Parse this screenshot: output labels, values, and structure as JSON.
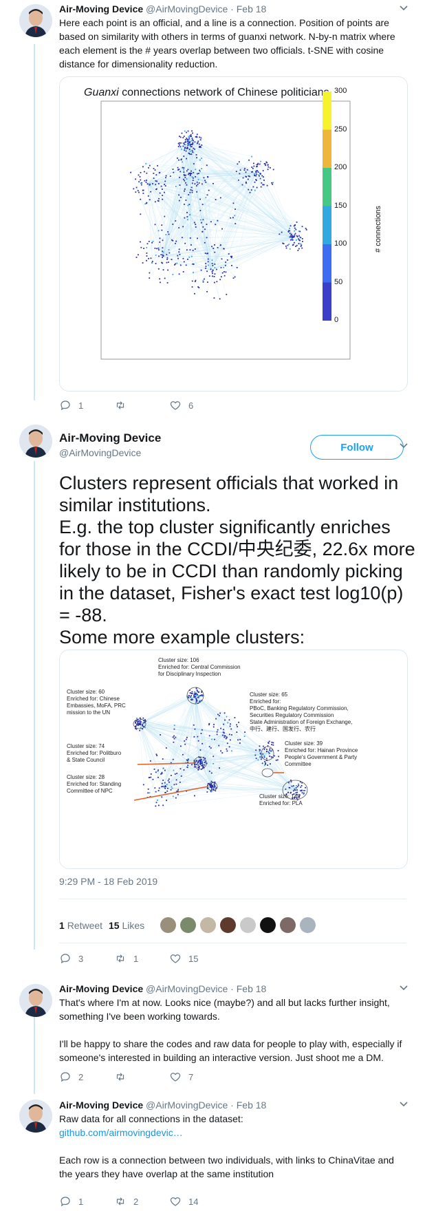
{
  "tweets": [
    {
      "name": "Air-Moving Device",
      "handle": "@AirMovingDevice",
      "date": "Feb 18",
      "text": "Here each point is an official, and a line is a connection. Position of points are based on similarity with others in terms of guanxi network. N-by-n matrix where each element is the # years overlap between two officials. t-SNE with cosine distance for dimensionality reduction.",
      "figure": {
        "title_italic": "Guanxi",
        "title_rest": " connections network of Chinese politicians",
        "colorbar_label": "# connections",
        "colorbar_ticks": [
          "300",
          "250",
          "200",
          "150",
          "100",
          "50",
          "0"
        ],
        "colorbar_colors": [
          "#f6f22e",
          "#eeb63a",
          "#44c884",
          "#2fa9e0",
          "#3d6cf3",
          "#3a3ec8",
          "#2c1d9a"
        ]
      },
      "replies": "1",
      "retweets": "",
      "likes": "6"
    },
    {
      "name": "Air-Moving Device",
      "handle": "@AirMovingDevice",
      "follow_label": "Follow",
      "text_lines": [
        "Clusters represent officials that worked in similar institutions.",
        "E.g. the top cluster significantly enriches for those in the CCDI/中央纪委, 22.6x more likely to be in CCDI than randomly picking in the dataset, Fisher's exact test log10(p) = -88.",
        "Some more example clusters:"
      ],
      "annotations": [
        "Cluster size: 106\nEnriched for: Central Commission\nfor Disciplinary Inspection",
        "Cluster size: 60\nEnriched for: Chinese\nEmbassies, MoFA, PRC\nmission to the UN",
        "Cluster size: 65\nEnriched for:\nPBoC, Banking Regulatory Commission,\nSecurities Regulatory Commission\nState Administration of Foreign Exchange,\n中行、建行、国发行、农行",
        "Cluster size: 74\nEnriched for: Politburo\n& State Council",
        "Cluster size: 39\nEnriched for: Hainan Province\nPeople's Government & Party\nCommittee",
        "Cluster size: 28\nEnriched for: Standing\nCommittee of NPC",
        "Cluster size: 148\nEnriched for: PLA"
      ],
      "timestamp": "9:29 PM - 18 Feb 2019",
      "retweet_count": "1",
      "retweet_label": "Retweet",
      "like_count": "15",
      "like_label": "Likes",
      "replies": "3",
      "retweets": "1",
      "likes": "15"
    },
    {
      "name": "Air-Moving Device",
      "handle": "@AirMovingDevice",
      "date": "Feb 18",
      "para1": "That's where I'm at now. Looks nice (maybe?) and all but lacks further insight, something I've been working towards.",
      "para2": "I'll be happy to share the codes and raw data for people to play with, especially if someone's interested in building an interactive version. Just shoot me a DM.",
      "replies": "2",
      "retweets": "",
      "likes": "7"
    },
    {
      "name": "Air-Moving Device",
      "handle": "@AirMovingDevice",
      "date": "Feb 18",
      "line1": "Raw data for all connections in the dataset:",
      "link": "github.com/airmovingdevic…",
      "para2": "Each row is a connection between two individuals, with links to ChinaVitae and the years they have overlap at the same institution",
      "replies": "1",
      "retweets": "2",
      "likes": "14"
    }
  ],
  "colors": {
    "accent": "#1da1f2",
    "text": "#14171a",
    "muted": "#657786",
    "thread_line": "#cde6f7",
    "node": "#2d2aa8",
    "edge": "#bfe3f2"
  }
}
